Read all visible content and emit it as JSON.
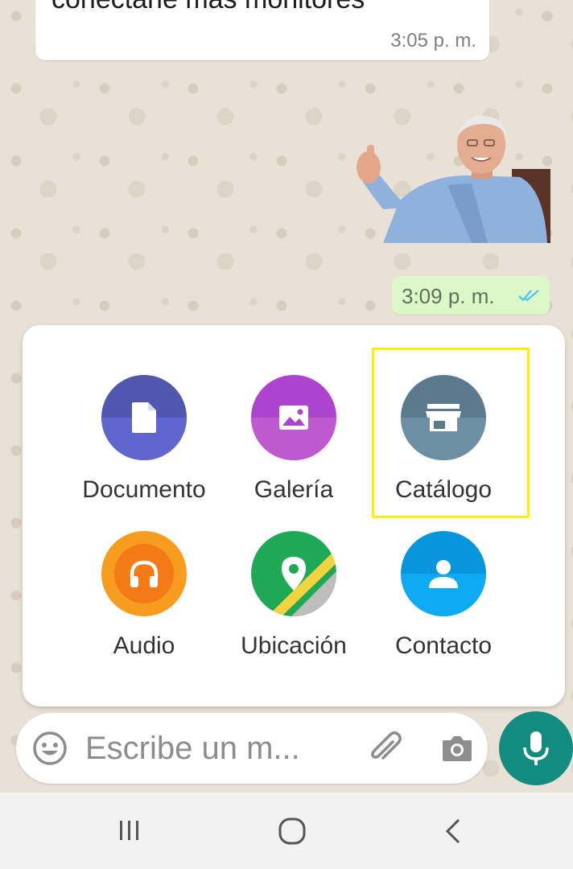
{
  "chat": {
    "incoming_message": {
      "text": "conectarle más monitores",
      "time": "3:05 p. m."
    },
    "outgoing_sticker": {
      "time": "3:09 p. m."
    }
  },
  "attach_menu": {
    "items": [
      {
        "label": "Documento",
        "icon": "document-icon",
        "color_top": "#5157AE",
        "color_bottom": "#5F66CD"
      },
      {
        "label": "Galería",
        "icon": "gallery-icon",
        "color_top": "#AC44CF",
        "color_bottom": "#BF59CF"
      },
      {
        "label": "Catálogo",
        "icon": "catalog-icon",
        "color_top": "#5B7A8D",
        "color_bottom": "#6D8FA3"
      },
      {
        "label": "Audio",
        "icon": "headphones-icon",
        "color_top": "#F47A15",
        "color_bottom": "#F79C1F"
      },
      {
        "label": "Ubicación",
        "icon": "location-icon",
        "color_top": "#1FA855",
        "color_bottom": "#20A85A"
      },
      {
        "label": "Contacto",
        "icon": "contact-icon",
        "color_top": "#0795DC",
        "color_bottom": "#0EABF4"
      }
    ],
    "highlight_color": "#FFF200"
  },
  "composer": {
    "placeholder": "Escribe un m...",
    "icons": [
      "emoji-icon",
      "attach-icon",
      "camera-icon",
      "mic-icon"
    ],
    "accent": "#128C7E"
  },
  "system_nav": {
    "buttons": [
      "recents-icon",
      "home-icon",
      "back-icon"
    ]
  }
}
